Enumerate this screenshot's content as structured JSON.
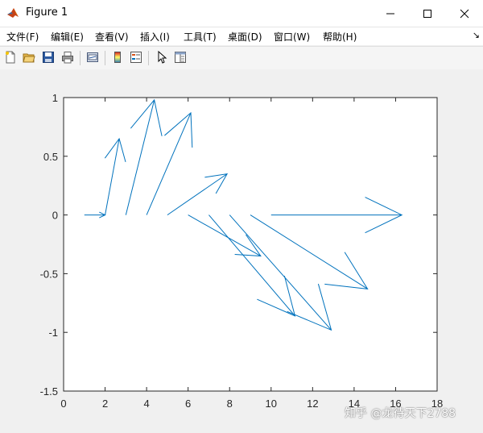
{
  "window": {
    "title": "Figure 1",
    "accent": "#0078d7"
  },
  "menu": {
    "items": [
      "文件(F)",
      "编辑(E)",
      "查看(V)",
      "插入(I)",
      "工具(T)",
      "桌面(D)",
      "窗口(W)",
      "帮助(H)"
    ],
    "overflow": "↘"
  },
  "toolbar": {
    "buttons": [
      "new-figure-icon",
      "open-file-icon",
      "save-icon",
      "print-icon",
      "link-icon",
      "colorbar-icon",
      "legend-icon",
      "pointer-icon",
      "property-editor-icon"
    ]
  },
  "chart_data": {
    "type": "line",
    "title": "",
    "xlabel": "",
    "ylabel": "",
    "xlim": [
      0,
      18
    ],
    "ylim": [
      -1.5,
      1
    ],
    "xticks": [
      0,
      2,
      4,
      6,
      8,
      10,
      12,
      14,
      16,
      18
    ],
    "yticks": [
      1,
      0.5,
      0,
      -0.5,
      -1,
      -1.5
    ],
    "xtick_labels": [
      "0",
      "2",
      "4",
      "6",
      "8",
      "10",
      "12",
      "14",
      "16",
      "18"
    ],
    "ytick_labels": [
      "1",
      "0.5",
      "0",
      "-0.5",
      "-1",
      "-1.5"
    ],
    "grid": false,
    "line_color": "#0072bd",
    "arrows": [
      {
        "x": 1,
        "y": 0,
        "u": 1.0,
        "v": 0.0
      },
      {
        "x": 2,
        "y": 0,
        "u": 0.68,
        "v": 0.65
      },
      {
        "x": 3,
        "y": 0,
        "u": 1.37,
        "v": 0.98
      },
      {
        "x": 4,
        "y": 0,
        "u": 2.13,
        "v": 0.87
      },
      {
        "x": 5,
        "y": 0,
        "u": 2.88,
        "v": 0.35
      },
      {
        "x": 6,
        "y": 0,
        "u": 3.5,
        "v": -0.35
      },
      {
        "x": 7,
        "y": 0,
        "u": 4.15,
        "v": -0.86
      },
      {
        "x": 8,
        "y": 0,
        "u": 4.9,
        "v": -0.98
      },
      {
        "x": 9,
        "y": 0,
        "u": 5.65,
        "v": -0.63
      },
      {
        "x": 10,
        "y": 0,
        "u": 6.3,
        "v": 0.0
      }
    ],
    "arrowhead": 0.12
  },
  "watermark": "知乎 @龙待天下2788"
}
